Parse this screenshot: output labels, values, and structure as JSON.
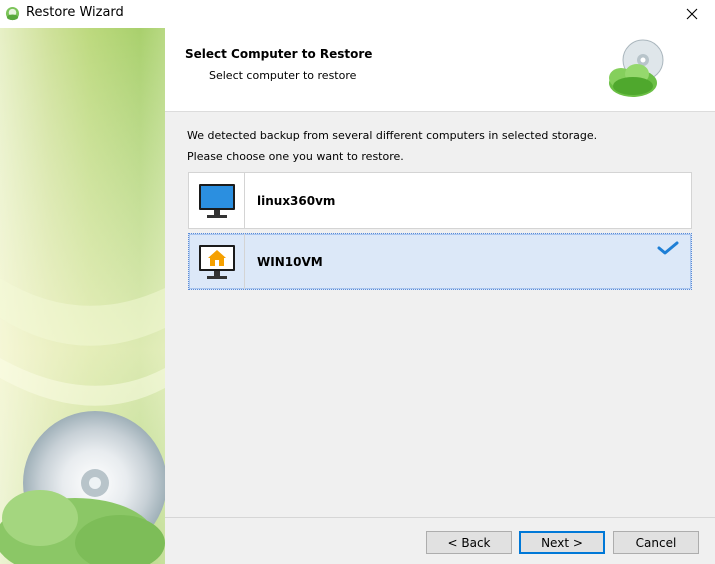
{
  "window": {
    "title": "Restore Wizard",
    "close_glyph": "✕"
  },
  "header": {
    "title": "Select Computer to Restore",
    "subtitle": "Select computer to restore",
    "icon": "disc-cloud-icon"
  },
  "content": {
    "line1": "We detected backup from several different computers in selected storage.",
    "line2": "Please choose one you want to restore."
  },
  "computers": [
    {
      "name": "linux360vm",
      "icon": "monitor-icon",
      "selected": false
    },
    {
      "name": "WIN10VM",
      "icon": "home-monitor-icon",
      "selected": true
    }
  ],
  "footer": {
    "back_label": "< Back",
    "next_label": "Next >",
    "cancel_label": "Cancel"
  },
  "colors": {
    "accent": "#0078d7",
    "selection": "#dce8f8",
    "side_green": "#bcd97d"
  }
}
